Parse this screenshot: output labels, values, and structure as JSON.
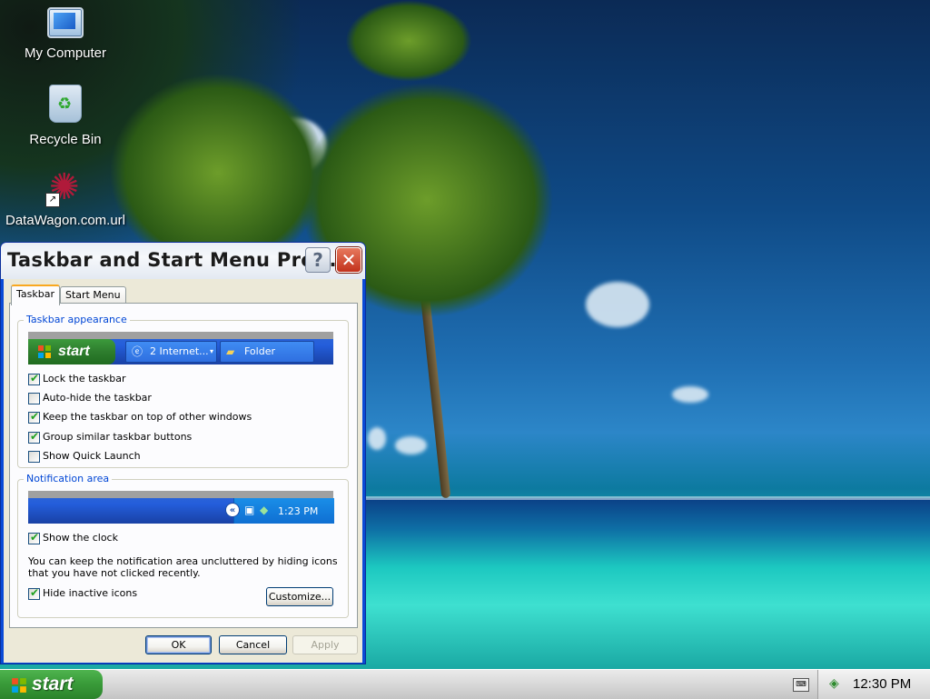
{
  "desktop": {
    "icons": [
      {
        "label": "My Computer"
      },
      {
        "label": "Recycle Bin"
      },
      {
        "label": "DataWagon.com.url"
      }
    ]
  },
  "dialog": {
    "title": "Taskbar and Start Menu Pro...",
    "tabs": [
      {
        "label": "Taskbar",
        "active": true
      },
      {
        "label": "Start Menu",
        "active": false
      }
    ],
    "taskbar_appearance": {
      "legend": "Taskbar appearance",
      "preview": {
        "start_label": "start",
        "tasks": [
          {
            "label": "2 Internet...",
            "icon": "ie-icon"
          },
          {
            "label": "Folder",
            "icon": "folder-icon"
          }
        ]
      },
      "options": [
        {
          "label": "Lock the taskbar",
          "checked": true
        },
        {
          "label": "Auto-hide the taskbar",
          "checked": false
        },
        {
          "label": "Keep the taskbar on top of other windows",
          "checked": true
        },
        {
          "label": "Group similar taskbar buttons",
          "checked": true
        },
        {
          "label": "Show Quick Launch",
          "checked": false
        }
      ]
    },
    "notification_area": {
      "legend": "Notification area",
      "preview_time": "1:23 PM",
      "options": [
        {
          "label": "Show the clock",
          "checked": true
        }
      ],
      "info_text": "You can keep the notification area uncluttered by hiding icons that you have not clicked recently.",
      "hide_inactive": {
        "label": "Hide inactive icons",
        "checked": true
      },
      "customize_label": "Customize..."
    },
    "buttons": {
      "ok": "OK",
      "cancel": "Cancel",
      "apply": "Apply"
    }
  },
  "taskbar": {
    "start_label": "start",
    "clock": "12:30 PM"
  },
  "colors": {
    "xp_blue": "#245edb",
    "start_green": "#3a9c3a",
    "legend_blue": "#0046d5",
    "close_red": "#c2311b"
  }
}
